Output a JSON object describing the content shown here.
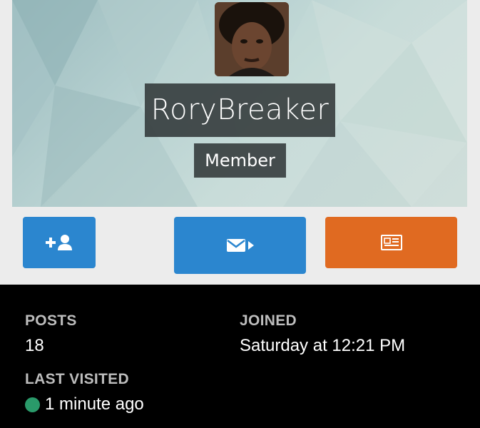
{
  "profile": {
    "username": "RoryBreaker",
    "role": "Member"
  },
  "actions": {
    "follow_icon": "user-plus-icon",
    "message_icon": "envelope-arrow-icon",
    "content_icon": "newspaper-icon"
  },
  "stats": {
    "posts_label": "POSTS",
    "posts_value": "18",
    "joined_label": "JOINED",
    "joined_value": "Saturday at 12:21 PM",
    "last_visited_label": "LAST VISITED",
    "last_visited_value": "1 minute ago"
  },
  "colors": {
    "primary_button": "#2b86cf",
    "accent_button": "#e06a21",
    "online_status": "#2a9a6a"
  }
}
